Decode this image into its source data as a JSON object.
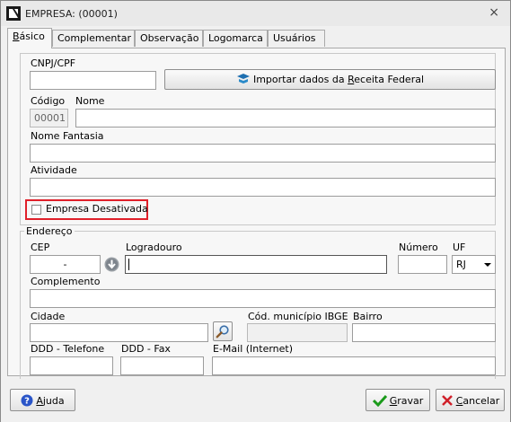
{
  "window": {
    "title": "EMPRESA: (00001)",
    "close_symbol": "×"
  },
  "tabs": [
    {
      "label": "Básico",
      "hotkey": "B",
      "rest": "ásico",
      "active": true
    },
    {
      "label": "Complementar",
      "active": false
    },
    {
      "label": "Observação",
      "active": false
    },
    {
      "label": "Logomarca",
      "active": false
    },
    {
      "label": "Usuários",
      "active": false
    }
  ],
  "basic": {
    "cnpj_label": "CNPJ/CPF",
    "cnpj_value": "",
    "import_button": {
      "pre": "Importar dados da ",
      "hotkey": "R",
      "post": "eceita Federal"
    },
    "codigo_label": "Código",
    "codigo_value": "00001",
    "nome_label": "Nome",
    "nome_value": "",
    "fantasia_label": "Nome Fantasia",
    "fantasia_value": "",
    "atividade_label": "Atividade",
    "atividade_value": "",
    "desativada_label": "Empresa Desativada",
    "desativada_checked": false
  },
  "endereco": {
    "legend": "Endereço",
    "cep_label": "CEP",
    "cep_value": "-",
    "logradouro_label": "Logradouro",
    "logradouro_value": "",
    "numero_label": "Número",
    "numero_value": "",
    "uf_label": "UF",
    "uf_value": "RJ",
    "complemento_label": "Complemento",
    "complemento_value": "",
    "cidade_label": "Cidade",
    "cidade_value": "",
    "ibge_label": "Cód. município IBGE",
    "ibge_value": "",
    "bairro_label": "Bairro",
    "bairro_value": "",
    "ddd_tel_label": "DDD - Telefone",
    "ddd_fax_label": "DDD - Fax",
    "email_label": "E-Mail (Internet)"
  },
  "footer": {
    "help": {
      "hotkey": "A",
      "rest": "juda"
    },
    "save": {
      "hotkey": "G",
      "rest": "ravar"
    },
    "cancel": {
      "hotkey": "C",
      "rest": "ancelar"
    }
  },
  "colors": {
    "highlight_border": "#e0202a",
    "save_check": "#1a9a1a",
    "cancel_x": "#d0202a",
    "help_icon": "#2a55c8"
  }
}
